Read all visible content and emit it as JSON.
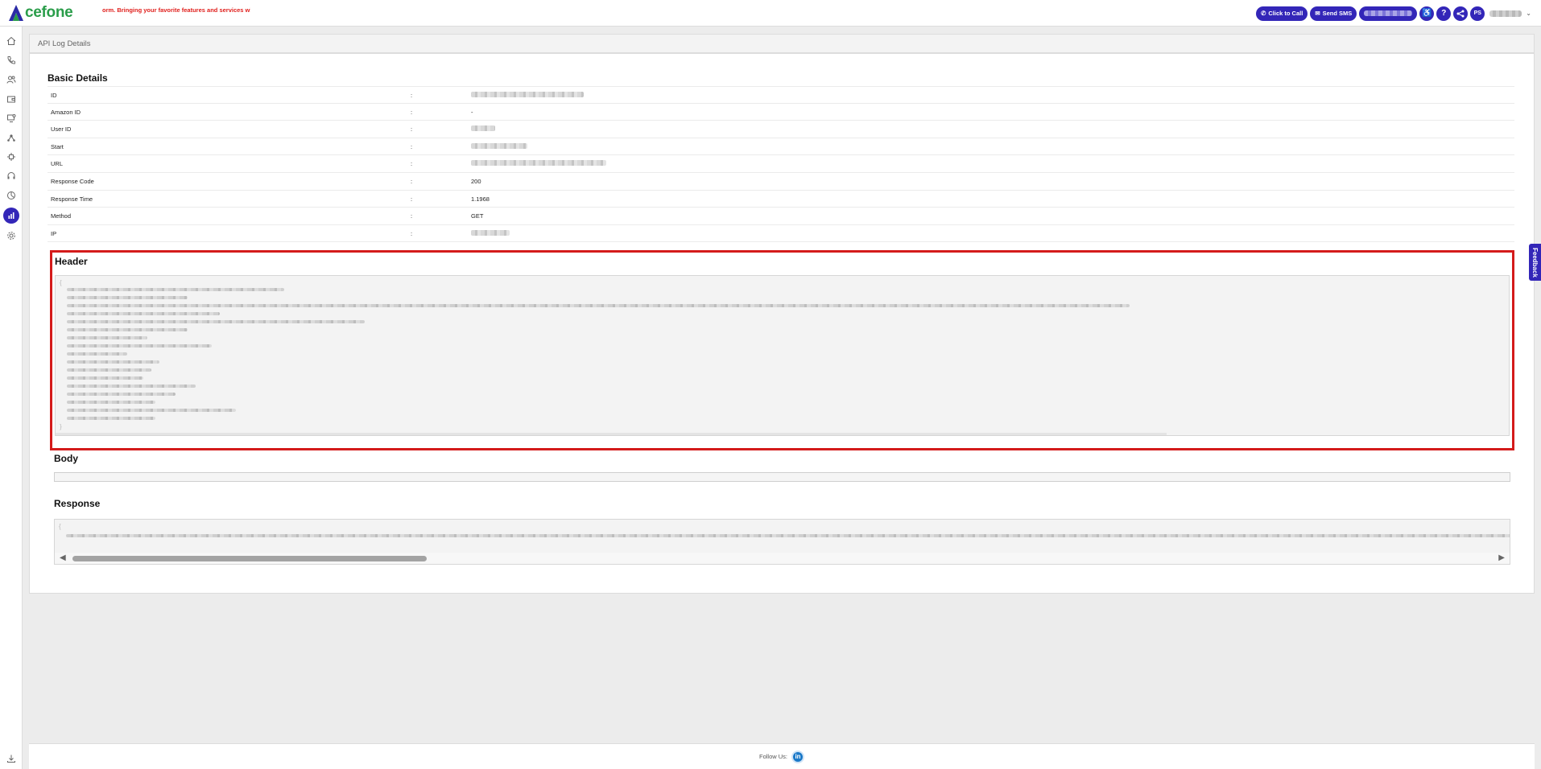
{
  "app": {
    "logo_text_a": "A",
    "logo_text_rest": "cefone",
    "announcement": "orm. Bringing your favorite features and services with a ne"
  },
  "topbar": {
    "click_to_call": "Click to Call",
    "send_sms": "Send SMS",
    "avatar_initials": "PS",
    "help_label": "?"
  },
  "breadcrumb": "API Log Details",
  "basic_details": {
    "title": "Basic Details",
    "rows": [
      {
        "label": "ID",
        "value": ""
      },
      {
        "label": "Amazon ID",
        "value": "-"
      },
      {
        "label": "User ID",
        "value": ""
      },
      {
        "label": "Start",
        "value": ""
      },
      {
        "label": "URL",
        "value": ""
      },
      {
        "label": "Response Code",
        "value": "200"
      },
      {
        "label": "Response Time",
        "value": "1.1968"
      },
      {
        "label": "Method",
        "value": "GET"
      },
      {
        "label": "IP",
        "value": ""
      }
    ],
    "separator": ":"
  },
  "sections": {
    "header_title": "Header",
    "body_title": "Body",
    "response_title": "Response"
  },
  "feedback_label": "Feedback",
  "footer": {
    "follow_label": "Follow Us:",
    "linkedin_label": "in"
  },
  "colors": {
    "brand": "#3326b8",
    "logo_green": "#2a9d4a",
    "highlight_red": "#d41b1b",
    "announcement_red": "#e0201d"
  }
}
